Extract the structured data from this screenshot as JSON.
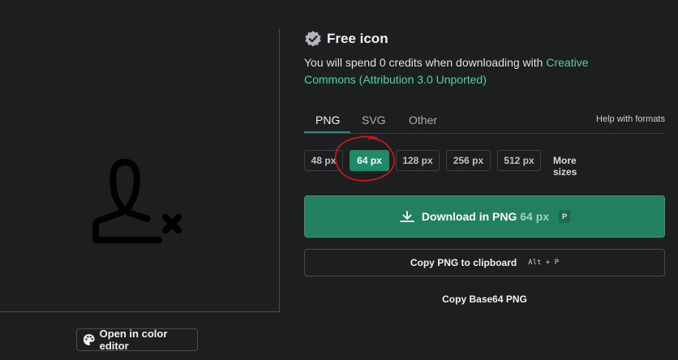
{
  "preview": {
    "icon": "remove-user-icon"
  },
  "color_editor": {
    "icon": "palette-icon",
    "label": "Open in color editor"
  },
  "header": {
    "badge_icon": "verified-badge-icon",
    "title": "Free icon"
  },
  "license": {
    "text": "You will spend 0 credits when downloading with ",
    "link_line1": "Creative",
    "link_line2": "Commons (Attribution 3.0 Unported)"
  },
  "tabs": [
    {
      "label": "PNG",
      "active": true
    },
    {
      "label": "SVG",
      "active": false
    },
    {
      "label": "Other",
      "active": false
    }
  ],
  "help_label": "Help with formats",
  "sizes": [
    {
      "label": "48 px",
      "selected": false
    },
    {
      "label": "64 px",
      "selected": true
    },
    {
      "label": "128 px",
      "selected": false
    },
    {
      "label": "256 px",
      "selected": false
    },
    {
      "label": "512 px",
      "selected": false
    }
  ],
  "more_sizes_label": "More sizes",
  "download": {
    "icon": "download-icon",
    "label": "Download in PNG",
    "size": "64 px",
    "shortcut": "P"
  },
  "copy_png": {
    "label": "Copy PNG to clipboard",
    "shortcut": "Alt + P"
  },
  "copy_base64": {
    "label": "Copy Base64 PNG"
  },
  "colors": {
    "accent": "#23805f",
    "link": "#4fd1a5",
    "annotation": "#d11a1a"
  }
}
